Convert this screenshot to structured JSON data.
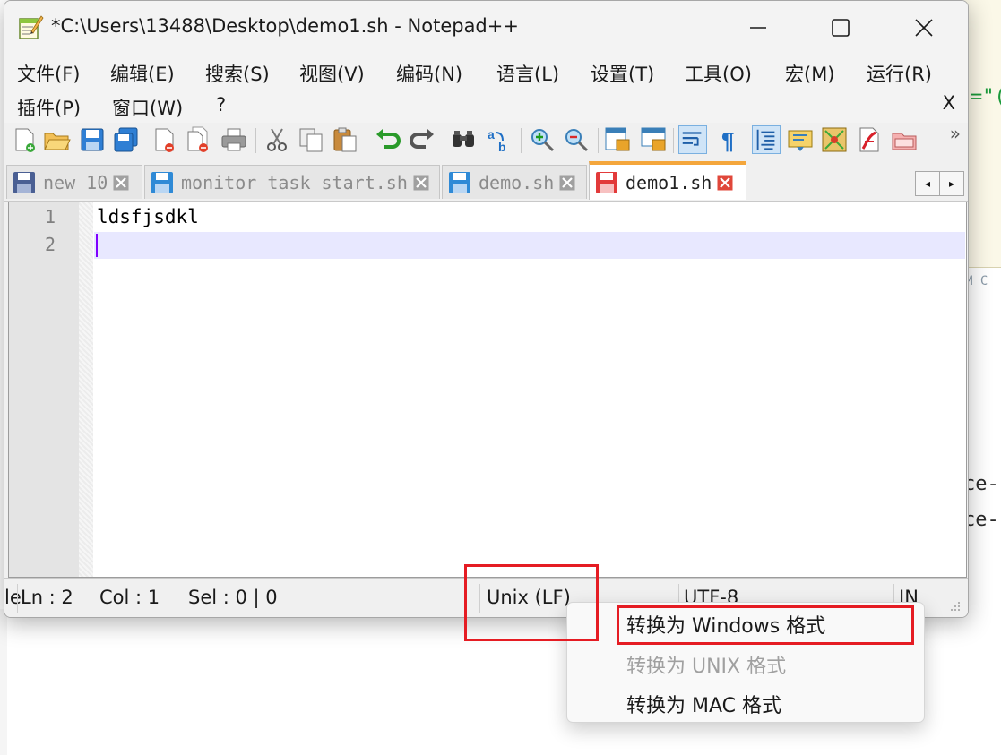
{
  "window": {
    "title": "*C:\\Users\\13488\\Desktop\\demo1.sh - Notepad++"
  },
  "menu": {
    "items": [
      "文件(F)",
      "编辑(E)",
      "搜索(S)",
      "视图(V)",
      "编码(N)",
      "语言(L)",
      "设置(T)",
      "工具(O)",
      "宏(M)",
      "运行(R)",
      "插件(P)",
      "窗口(W)",
      "?"
    ],
    "close_x": "X"
  },
  "toolbar": {
    "icons": [
      "new-file",
      "open-file",
      "save",
      "save-all",
      "close",
      "close-all",
      "print",
      "cut",
      "copy",
      "paste",
      "undo",
      "redo",
      "find",
      "replace",
      "zoom-in",
      "zoom-out",
      "sync-vertical",
      "sync-horizontal",
      "word-wrap",
      "show-all-chars",
      "indent-guide",
      "doc-map",
      "function-list",
      "macro-record",
      "folder-workspace"
    ],
    "more": "»"
  },
  "tabs": [
    {
      "label": "new 10",
      "active": false,
      "modified": false
    },
    {
      "label": "monitor_task_start.sh",
      "active": false,
      "modified": false
    },
    {
      "label": "demo.sh",
      "active": false,
      "modified": false
    },
    {
      "label": "demo1.sh",
      "active": true,
      "modified": true
    }
  ],
  "tab_nav": {
    "prev": "◂",
    "next": "▸"
  },
  "editor": {
    "lines": [
      {
        "no": "1",
        "text": "ldsfjsdkl"
      },
      {
        "no": "2",
        "text": ""
      }
    ]
  },
  "status": {
    "cut_left": "le",
    "ln": "Ln : 2",
    "col": "Col : 1",
    "sel": "Sel : 0 | 0",
    "eol": "Unix (LF)",
    "encoding": "UTF-8",
    "ins": "IN"
  },
  "context_menu": {
    "items": [
      {
        "label": "转换为 Windows 格式",
        "enabled": true,
        "highlighted": true
      },
      {
        "label": "转换为 UNIX 格式",
        "enabled": false,
        "highlighted": false
      },
      {
        "label": "转换为 MAC 格式",
        "enabled": true,
        "highlighted": false
      }
    ]
  },
  "background": {
    "fragment_top": "=\"(",
    "fragment_mid": "M C",
    "fragment_line1": "ce-",
    "fragment_line2": "ce-"
  },
  "colors": {
    "accent_tab": "#f4a63c",
    "annotation_red": "#e51c23",
    "current_line": "#e8e8ff",
    "caret": "#8000ff"
  }
}
